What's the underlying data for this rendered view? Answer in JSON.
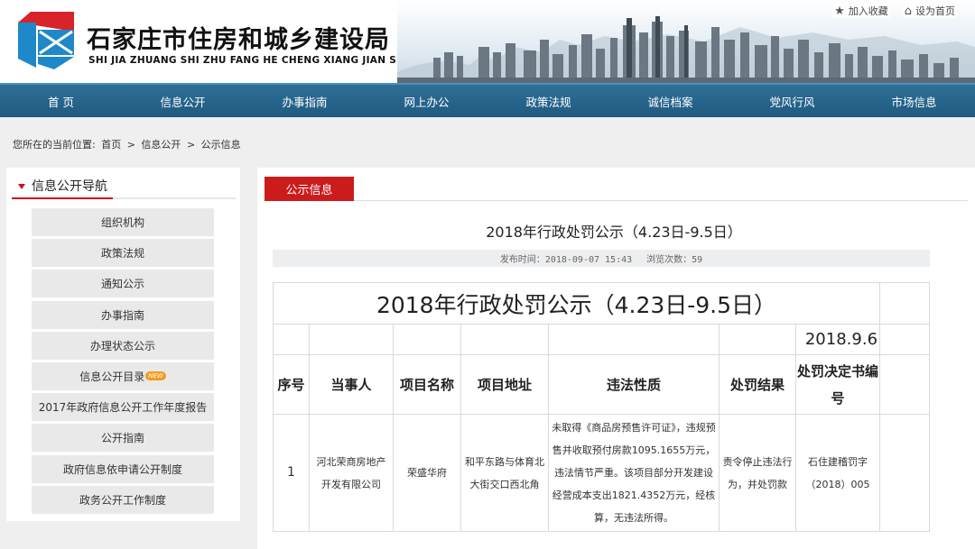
{
  "header": {
    "title": "石家庄市住房和城乡建设局",
    "subtitle": "SHI JIA ZHUANG SHI ZHU FANG HE CHENG XIANG JIAN SHE JU",
    "links": [
      {
        "icon": "star-icon",
        "label": "加入收藏"
      },
      {
        "icon": "home-icon",
        "label": "设为首页"
      }
    ]
  },
  "nav": [
    "首 页",
    "信息公开",
    "办事指南",
    "网上办公",
    "政策法规",
    "诚信档案",
    "党风行风",
    "市场信息"
  ],
  "breadcrumb": {
    "label": "您所在的当前位置:",
    "items": [
      "首页",
      ">",
      "信息公开",
      ">",
      "公示信息"
    ]
  },
  "sidebar": {
    "title": "信息公开导航",
    "items": [
      {
        "label": "组织机构"
      },
      {
        "label": "政策法规"
      },
      {
        "label": "通知公示"
      },
      {
        "label": "办事指南"
      },
      {
        "label": "办理状态公示"
      },
      {
        "label": "信息公开目录",
        "badge": "NEW"
      },
      {
        "label": "2017年政府信息公开工作年度报告"
      },
      {
        "label": "公开指南"
      },
      {
        "label": "政府信息依申请公开制度"
      },
      {
        "label": "政务公开工作制度"
      }
    ]
  },
  "main": {
    "tab": "公示信息",
    "title": "2018年行政处罚公示（4.23日-9.5日）",
    "publish_label": "发布时间：",
    "publish_time": "2018-09-07 15:43",
    "views_label": "浏览次数：",
    "views": "59",
    "table": {
      "title": "2018年行政处罚公示（4.23日-9.5日）",
      "date": "2018.9.6",
      "headers": [
        "序号",
        "当事人",
        "项目名称",
        "项目地址",
        "违法性质",
        "处罚结果",
        "处罚决定书编号"
      ],
      "rows": [
        {
          "no": "1",
          "party": "河北荣商房地产开发有限公司",
          "project": "荣盛华府",
          "address": "和平东路与体育北大街交口西北角",
          "violation": "未取得《商品房预售许可证》，违规预售并收取预付房款1095.1655万元，违法情节严重。该项目部分开发建设经营成本支出1821.4352万元，经核算，无违法所得。",
          "result": "责令停止违法行为，并处罚款",
          "decision": "石住建稽罚字（2018）005"
        }
      ]
    }
  },
  "colors": {
    "nav_bg": "#2a6790",
    "tab_red": "#cc1b1b",
    "logo_red": "#d8232a",
    "logo_blue": "#1e88c8"
  }
}
